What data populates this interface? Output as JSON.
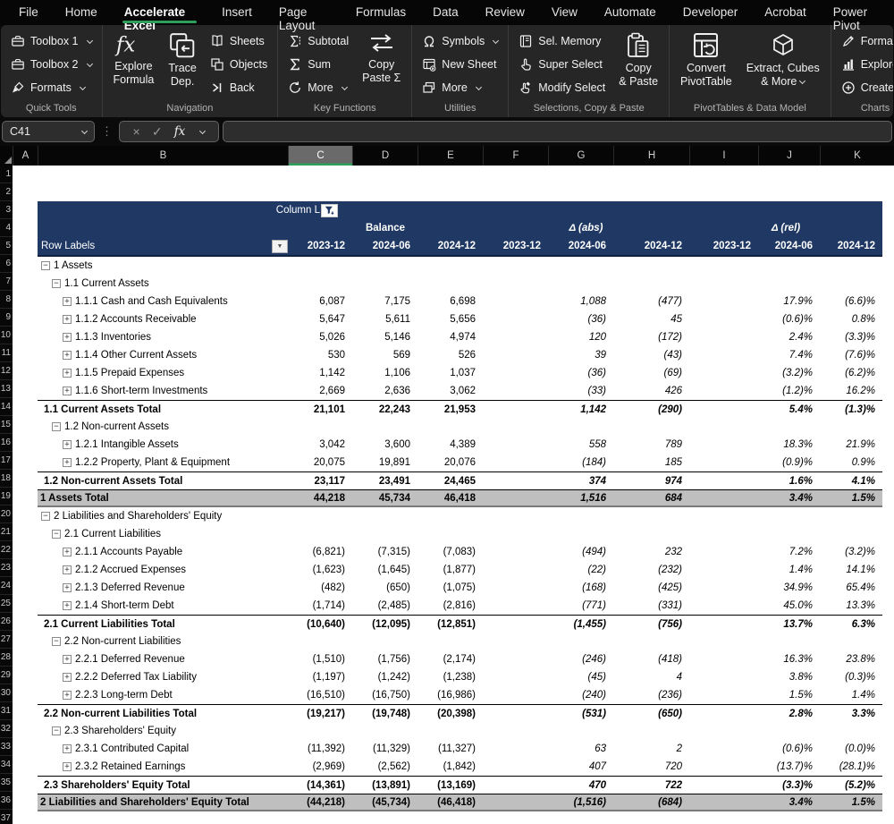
{
  "tabs": {
    "items": [
      {
        "label": "File"
      },
      {
        "label": "Home"
      },
      {
        "label": "Accelerate Excel",
        "active": true
      },
      {
        "label": "Insert"
      },
      {
        "label": "Page Layout"
      },
      {
        "label": "Formulas"
      },
      {
        "label": "Data"
      },
      {
        "label": "Review"
      },
      {
        "label": "View"
      },
      {
        "label": "Automate"
      },
      {
        "label": "Developer"
      },
      {
        "label": "Acrobat"
      },
      {
        "label": "Power Pivot"
      }
    ]
  },
  "ribbon": {
    "groups": [
      {
        "label": "Quick Tools",
        "items": [
          {
            "kind": "stack",
            "buttons": [
              {
                "icon": "toolbox-icon",
                "label": "Toolbox 1",
                "chevron": true
              },
              {
                "icon": "toolbox-icon",
                "label": "Toolbox 2",
                "chevron": true
              },
              {
                "icon": "brush-icon",
                "label": "Formats",
                "chevron": true
              }
            ]
          }
        ]
      },
      {
        "label": "Navigation",
        "items": [
          {
            "kind": "big",
            "icon": "fx-icon",
            "lines": [
              "Explore",
              "Formula"
            ]
          },
          {
            "kind": "big",
            "icon": "trace-dep-icon",
            "lines": [
              "Trace",
              "Dep."
            ]
          },
          {
            "kind": "stack",
            "buttons": [
              {
                "icon": "sheets-book-icon",
                "label": "Sheets"
              },
              {
                "icon": "objects-icon",
                "label": "Objects"
              },
              {
                "icon": "back-icon",
                "label": "Back"
              }
            ]
          }
        ]
      },
      {
        "label": "Key Functions",
        "items": [
          {
            "kind": "stack",
            "buttons": [
              {
                "icon": "subtotal-icon",
                "label": "Subtotal"
              },
              {
                "icon": "sigma-icon",
                "label": "Sum"
              },
              {
                "icon": "refresh-icon",
                "label": "More",
                "chevron": true
              }
            ]
          },
          {
            "kind": "big",
            "icon": "copy-paste-arrows-icon",
            "lines": [
              "Copy",
              "Paste Σ"
            ]
          }
        ]
      },
      {
        "label": "Utilities",
        "items": [
          {
            "kind": "stack",
            "buttons": [
              {
                "icon": "omega-icon",
                "label": "Symbols",
                "chevron": true
              },
              {
                "icon": "new-sheet-icon",
                "label": "New Sheet"
              },
              {
                "icon": "windows-icon",
                "label": "More",
                "chevron": true
              }
            ]
          }
        ]
      },
      {
        "label": "Selections, Copy & Paste",
        "items": [
          {
            "kind": "stack",
            "buttons": [
              {
                "icon": "memory-icon",
                "label": "Sel. Memory"
              },
              {
                "icon": "hand-select-icon",
                "label": "Super Select"
              },
              {
                "icon": "hand-modify-icon",
                "label": "Modify Select"
              }
            ]
          },
          {
            "kind": "big",
            "icon": "clipboard-icon",
            "lines": [
              "Copy",
              "& Paste"
            ]
          }
        ]
      },
      {
        "label": "PivotTables & Data Model",
        "items": [
          {
            "kind": "big",
            "icon": "pivot-convert-icon",
            "lines": [
              "Convert",
              "PivotTable"
            ]
          },
          {
            "kind": "big",
            "icon": "cube-icon",
            "lines": [
              "Extract, Cubes",
              "& More"
            ],
            "chevron": true
          }
        ]
      },
      {
        "label": "Charts",
        "items": [
          {
            "kind": "stack",
            "buttons": [
              {
                "icon": "format-pen-icon",
                "label": "Format",
                "chevron": true
              },
              {
                "icon": "chart-bars-icon",
                "label": "Explore"
              },
              {
                "icon": "plus-circle-icon",
                "label": "Create",
                "chevron": true
              }
            ]
          }
        ]
      }
    ]
  },
  "formula_bar": {
    "name_box": "C41",
    "formula_value": "",
    "cancel_glyph": "×",
    "enter_glyph": "✓",
    "fx_glyph": "fx"
  },
  "grid": {
    "columns": [
      "A",
      "B",
      "C",
      "D",
      "E",
      "F",
      "G",
      "H",
      "I",
      "J",
      "K"
    ],
    "selected_column": "C",
    "row_count": 37
  },
  "pivot": {
    "filter_field_label": "Column L",
    "row_labels_label": "Row Labels",
    "value_groups": [
      "Balance",
      "Δ (abs)",
      "Δ (rel)"
    ],
    "periods": [
      "2023-12",
      "2024-06",
      "2024-12"
    ],
    "rows": [
      {
        "label": "1 Assets",
        "level": 0,
        "expand": "minus",
        "type": "group",
        "values": [
          "",
          "",
          "",
          "",
          "",
          "",
          "",
          "",
          ""
        ]
      },
      {
        "label": "1.1 Current Assets",
        "level": 1,
        "expand": "minus",
        "type": "group",
        "values": [
          "",
          "",
          "",
          "",
          "",
          "",
          "",
          "",
          ""
        ]
      },
      {
        "label": "1.1.1 Cash and Cash Equivalents",
        "level": 2,
        "expand": "plus",
        "type": "item",
        "values": [
          "6,087",
          "7,175",
          "6,698",
          "",
          "1,088",
          "(477)",
          "",
          "17.9%",
          "(6.6)%"
        ]
      },
      {
        "label": "1.1.2 Accounts Receivable",
        "level": 2,
        "expand": "plus",
        "type": "item",
        "values": [
          "5,647",
          "5,611",
          "5,656",
          "",
          "(36)",
          "45",
          "",
          "(0.6)%",
          "0.8%"
        ]
      },
      {
        "label": "1.1.3 Inventories",
        "level": 2,
        "expand": "plus",
        "type": "item",
        "values": [
          "5,026",
          "5,146",
          "4,974",
          "",
          "120",
          "(172)",
          "",
          "2.4%",
          "(3.3)%"
        ]
      },
      {
        "label": "1.1.4 Other Current Assets",
        "level": 2,
        "expand": "plus",
        "type": "item",
        "values": [
          "530",
          "569",
          "526",
          "",
          "39",
          "(43)",
          "",
          "7.4%",
          "(7.6)%"
        ]
      },
      {
        "label": "1.1.5 Prepaid Expenses",
        "level": 2,
        "expand": "plus",
        "type": "item",
        "values": [
          "1,142",
          "1,106",
          "1,037",
          "",
          "(36)",
          "(69)",
          "",
          "(3.2)%",
          "(6.2)%"
        ]
      },
      {
        "label": "1.1.6 Short-term Investments",
        "level": 2,
        "expand": "plus",
        "type": "item",
        "values": [
          "2,669",
          "2,636",
          "3,062",
          "",
          "(33)",
          "426",
          "",
          "(1.2)%",
          "16.2%"
        ]
      },
      {
        "label": "1.1 Current Assets Total",
        "type": "total",
        "values": [
          "21,101",
          "22,243",
          "21,953",
          "",
          "1,142",
          "(290)",
          "",
          "5.4%",
          "(1.3)%"
        ]
      },
      {
        "label": "1.2 Non-current Assets",
        "level": 1,
        "expand": "minus",
        "type": "group",
        "values": [
          "",
          "",
          "",
          "",
          "",
          "",
          "",
          "",
          ""
        ]
      },
      {
        "label": "1.2.1 Intangible Assets",
        "level": 2,
        "expand": "plus",
        "type": "item",
        "values": [
          "3,042",
          "3,600",
          "4,389",
          "",
          "558",
          "789",
          "",
          "18.3%",
          "21.9%"
        ]
      },
      {
        "label": "1.2.2 Property, Plant & Equipment",
        "level": 2,
        "expand": "plus",
        "type": "item",
        "values": [
          "20,075",
          "19,891",
          "20,076",
          "",
          "(184)",
          "185",
          "",
          "(0.9)%",
          "0.9%"
        ]
      },
      {
        "label": "1.2 Non-current Assets Total",
        "type": "total",
        "values": [
          "23,117",
          "23,491",
          "24,465",
          "",
          "374",
          "974",
          "",
          "1.6%",
          "4.1%"
        ]
      },
      {
        "label": "1 Assets Total",
        "type": "grand",
        "values": [
          "44,218",
          "45,734",
          "46,418",
          "",
          "1,516",
          "684",
          "",
          "3.4%",
          "1.5%"
        ]
      },
      {
        "label": "2 Liabilities and Shareholders' Equity",
        "level": 0,
        "expand": "minus",
        "type": "group",
        "values": [
          "",
          "",
          "",
          "",
          "",
          "",
          "",
          "",
          ""
        ]
      },
      {
        "label": "2.1 Current Liabilities",
        "level": 1,
        "expand": "minus",
        "type": "group",
        "values": [
          "",
          "",
          "",
          "",
          "",
          "",
          "",
          "",
          ""
        ]
      },
      {
        "label": "2.1.1 Accounts Payable",
        "level": 2,
        "expand": "plus",
        "type": "item",
        "values": [
          "(6,821)",
          "(7,315)",
          "(7,083)",
          "",
          "(494)",
          "232",
          "",
          "7.2%",
          "(3.2)%"
        ]
      },
      {
        "label": "2.1.2 Accrued Expenses",
        "level": 2,
        "expand": "plus",
        "type": "item",
        "values": [
          "(1,623)",
          "(1,645)",
          "(1,877)",
          "",
          "(22)",
          "(232)",
          "",
          "1.4%",
          "14.1%"
        ]
      },
      {
        "label": "2.1.3 Deferred Revenue",
        "level": 2,
        "expand": "plus",
        "type": "item",
        "values": [
          "(482)",
          "(650)",
          "(1,075)",
          "",
          "(168)",
          "(425)",
          "",
          "34.9%",
          "65.4%"
        ]
      },
      {
        "label": "2.1.4 Short-term Debt",
        "level": 2,
        "expand": "plus",
        "type": "item",
        "values": [
          "(1,714)",
          "(2,485)",
          "(2,816)",
          "",
          "(771)",
          "(331)",
          "",
          "45.0%",
          "13.3%"
        ]
      },
      {
        "label": "2.1 Current Liabilities Total",
        "type": "total",
        "values": [
          "(10,640)",
          "(12,095)",
          "(12,851)",
          "",
          "(1,455)",
          "(756)",
          "",
          "13.7%",
          "6.3%"
        ]
      },
      {
        "label": "2.2 Non-current Liabilities",
        "level": 1,
        "expand": "minus",
        "type": "group",
        "values": [
          "",
          "",
          "",
          "",
          "",
          "",
          "",
          "",
          ""
        ]
      },
      {
        "label": "2.2.1 Deferred Revenue",
        "level": 2,
        "expand": "plus",
        "type": "item",
        "values": [
          "(1,510)",
          "(1,756)",
          "(2,174)",
          "",
          "(246)",
          "(418)",
          "",
          "16.3%",
          "23.8%"
        ]
      },
      {
        "label": "2.2.2 Deferred Tax Liability",
        "level": 2,
        "expand": "plus",
        "type": "item",
        "values": [
          "(1,197)",
          "(1,242)",
          "(1,238)",
          "",
          "(45)",
          "4",
          "",
          "3.8%",
          "(0.3)%"
        ]
      },
      {
        "label": "2.2.3 Long-term Debt",
        "level": 2,
        "expand": "plus",
        "type": "item",
        "values": [
          "(16,510)",
          "(16,750)",
          "(16,986)",
          "",
          "(240)",
          "(236)",
          "",
          "1.5%",
          "1.4%"
        ]
      },
      {
        "label": "2.2 Non-current Liabilities Total",
        "type": "total",
        "values": [
          "(19,217)",
          "(19,748)",
          "(20,398)",
          "",
          "(531)",
          "(650)",
          "",
          "2.8%",
          "3.3%"
        ]
      },
      {
        "label": "2.3 Shareholders' Equity",
        "level": 1,
        "expand": "minus",
        "type": "group",
        "values": [
          "",
          "",
          "",
          "",
          "",
          "",
          "",
          "",
          ""
        ]
      },
      {
        "label": "2.3.1 Contributed Capital",
        "level": 2,
        "expand": "plus",
        "type": "item",
        "values": [
          "(11,392)",
          "(11,329)",
          "(11,327)",
          "",
          "63",
          "2",
          "",
          "(0.6)%",
          "(0.0)%"
        ]
      },
      {
        "label": "2.3.2 Retained Earnings",
        "level": 2,
        "expand": "plus",
        "type": "item",
        "values": [
          "(2,969)",
          "(2,562)",
          "(1,842)",
          "",
          "407",
          "720",
          "",
          "(13.7)%",
          "(28.1)%"
        ]
      },
      {
        "label": "2.3 Shareholders' Equity Total",
        "type": "total",
        "values": [
          "(14,361)",
          "(13,891)",
          "(13,169)",
          "",
          "470",
          "722",
          "",
          "(3.3)%",
          "(5.2)%"
        ]
      },
      {
        "label": "2 Liabilities and Shareholders' Equity Total",
        "type": "grand",
        "values": [
          "(44,218)",
          "(45,734)",
          "(46,418)",
          "",
          "(1,516)",
          "(684)",
          "",
          "3.4%",
          "1.5%"
        ]
      }
    ]
  },
  "colors": {
    "accent_green": "#2e9e5b",
    "header_navy": "#1f3864",
    "grand_row_gray": "#bfbfbf"
  }
}
